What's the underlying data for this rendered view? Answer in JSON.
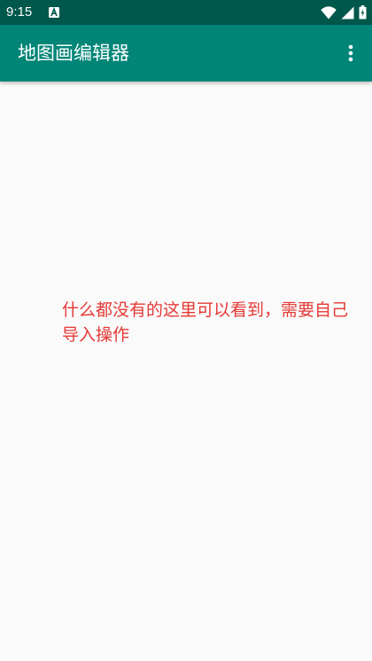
{
  "status_bar": {
    "time": "9:15",
    "notification_icon": "a-letter-icon",
    "wifi_icon": "wifi-icon",
    "signal_icon": "cell-signal-icon",
    "battery_icon": "battery-icon"
  },
  "app_bar": {
    "title": "地图画编辑器",
    "overflow_icon": "more-vert-icon"
  },
  "main": {
    "empty_message": "什么都没有的这里可以看到，需要自己导入操作"
  },
  "colors": {
    "status_bar": "#00574b",
    "app_bar": "#008577",
    "background": "#fafafa",
    "message": "#e53935"
  }
}
